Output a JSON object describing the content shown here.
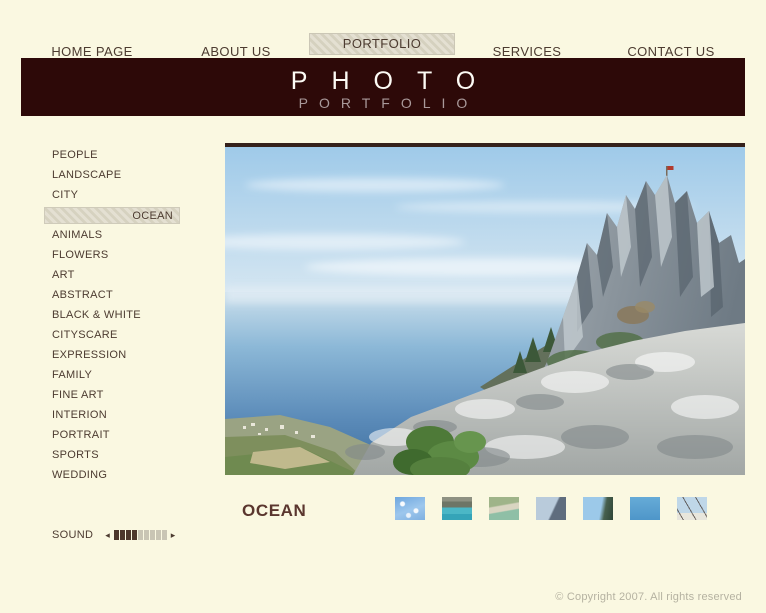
{
  "nav": {
    "items": [
      {
        "label": "HOME PAGE",
        "active": false
      },
      {
        "label": "ABOUT US",
        "active": false
      },
      {
        "label": "PORTFOLIO",
        "active": true
      },
      {
        "label": "SERVICES",
        "active": false
      },
      {
        "label": "CONTACT US",
        "active": false
      }
    ]
  },
  "header": {
    "title": "PHOTO",
    "subtitle": "PORTFOLIO"
  },
  "sidebar": {
    "selected": "OCEAN",
    "items": [
      {
        "label": "PEOPLE"
      },
      {
        "label": "LANDSCAPE"
      },
      {
        "label": "CITY"
      },
      {
        "label": "OCEAN",
        "selected": true
      },
      {
        "label": "ANIMALS"
      },
      {
        "label": "FLOWERS"
      },
      {
        "label": "ART"
      },
      {
        "label": "ABSTRACT"
      },
      {
        "label": "BLACK & WHITE"
      },
      {
        "label": "CITYSCARE"
      },
      {
        "label": "EXPRESSION"
      },
      {
        "label": "FAMILY"
      },
      {
        "label": "FINE ART"
      },
      {
        "label": "INTERION"
      },
      {
        "label": "PORTRAIT"
      },
      {
        "label": "SPORTS"
      },
      {
        "label": "WEDDING"
      }
    ]
  },
  "gallery": {
    "category_title": "OCEAN",
    "main_photo_subject": "rocky mountain pinnacles over hazy blue sea with coastal town below",
    "thumbnails": [
      {
        "name": "sparkling-water"
      },
      {
        "name": "rocky-pier"
      },
      {
        "name": "beach-shore"
      },
      {
        "name": "coastal-rocks-clouds"
      },
      {
        "name": "cliff-trees-sky"
      },
      {
        "name": "open-blue-sea"
      },
      {
        "name": "sailboat-rigging"
      }
    ]
  },
  "sound": {
    "label": "SOUND",
    "down_icon": "◂",
    "up_icon": "▸",
    "segments": 9,
    "level": 4
  },
  "footer": {
    "copyright": "© Copyright 2007. All rights reserved"
  },
  "colors": {
    "page_background": "#FAF8E1",
    "header_band": "#2D0908",
    "active_tab": "#DDD8C8",
    "nav_text": "#4C3B30",
    "category_heading": "#5A362E",
    "copyright_text": "#B5B2A1"
  }
}
